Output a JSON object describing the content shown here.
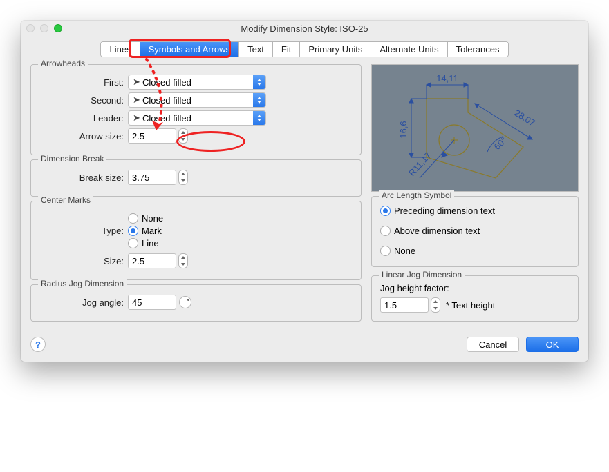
{
  "title": "Modify Dimension Style: ISO-25",
  "tabs": [
    "Lines",
    "Symbols and Arrows",
    "Text",
    "Fit",
    "Primary Units",
    "Alternate Units",
    "Tolerances"
  ],
  "active_tab": "Symbols and Arrows",
  "arrowheads": {
    "legend": "Arrowheads",
    "first_label": "First:",
    "first_value": "Closed filled",
    "second_label": "Second:",
    "second_value": "Closed filled",
    "leader_label": "Leader:",
    "leader_value": "Closed filled",
    "arrow_size_label": "Arrow size:",
    "arrow_size_value": "2.5"
  },
  "dimension_break": {
    "legend": "Dimension Break",
    "break_size_label": "Break size:",
    "break_size_value": "3.75"
  },
  "center_marks": {
    "legend": "Center Marks",
    "type_label": "Type:",
    "options": {
      "none": "None",
      "mark": "Mark",
      "line": "Line"
    },
    "selected": "mark",
    "size_label": "Size:",
    "size_value": "2.5"
  },
  "radius_jog": {
    "legend": "Radius Jog Dimension",
    "jog_angle_label": "Jog angle:",
    "jog_angle_value": "45"
  },
  "arc_length": {
    "legend": "Arc Length Symbol",
    "options": {
      "preceding": "Preceding dimension text",
      "above": "Above dimension text",
      "none": "None"
    },
    "selected": "preceding"
  },
  "linear_jog": {
    "legend": "Linear Jog Dimension",
    "factor_label": "Jog height factor:",
    "factor_value": "1.5",
    "suffix": "* Text height"
  },
  "preview_labels": {
    "top": "14,11",
    "left": "16,6",
    "right": "28,07",
    "angle": "60°",
    "radius": "R11,17"
  },
  "buttons": {
    "cancel": "Cancel",
    "ok": "OK"
  }
}
